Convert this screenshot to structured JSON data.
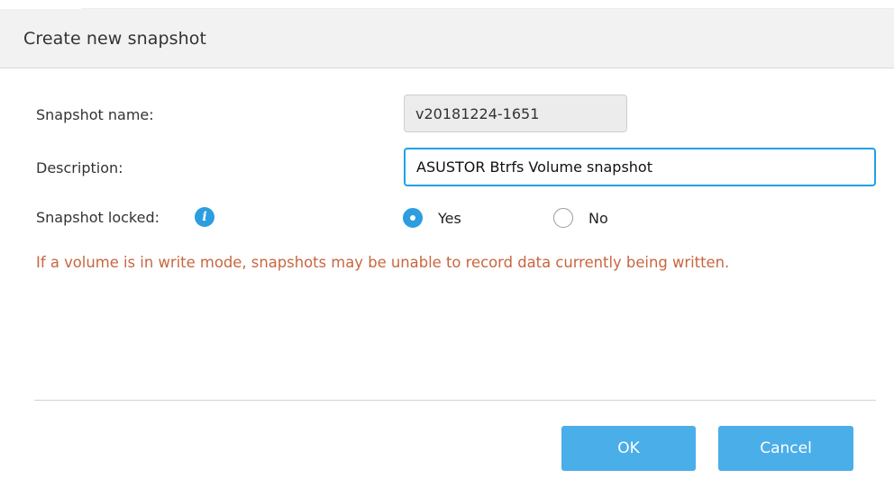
{
  "dialog": {
    "title": "Create new snapshot"
  },
  "form": {
    "snapshot_name_label": "Snapshot name:",
    "snapshot_name_value": "v20181224-1651",
    "description_label": "Description:",
    "description_value": "ASUSTOR Btrfs Volume snapshot",
    "snapshot_locked_label": "Snapshot locked:",
    "info_icon_glyph": "i",
    "locked_options": [
      {
        "label": "Yes",
        "selected": true
      },
      {
        "label": "No",
        "selected": false
      }
    ],
    "warning_text": "If a volume is in write mode, snapshots may be unable to record data currently being written."
  },
  "buttons": {
    "ok_label": "OK",
    "cancel_label": "Cancel"
  },
  "colors": {
    "accent": "#2c9ee0",
    "button": "#4aaee9",
    "warning": "#c8663f",
    "focus_border": "#1ea3e4"
  }
}
